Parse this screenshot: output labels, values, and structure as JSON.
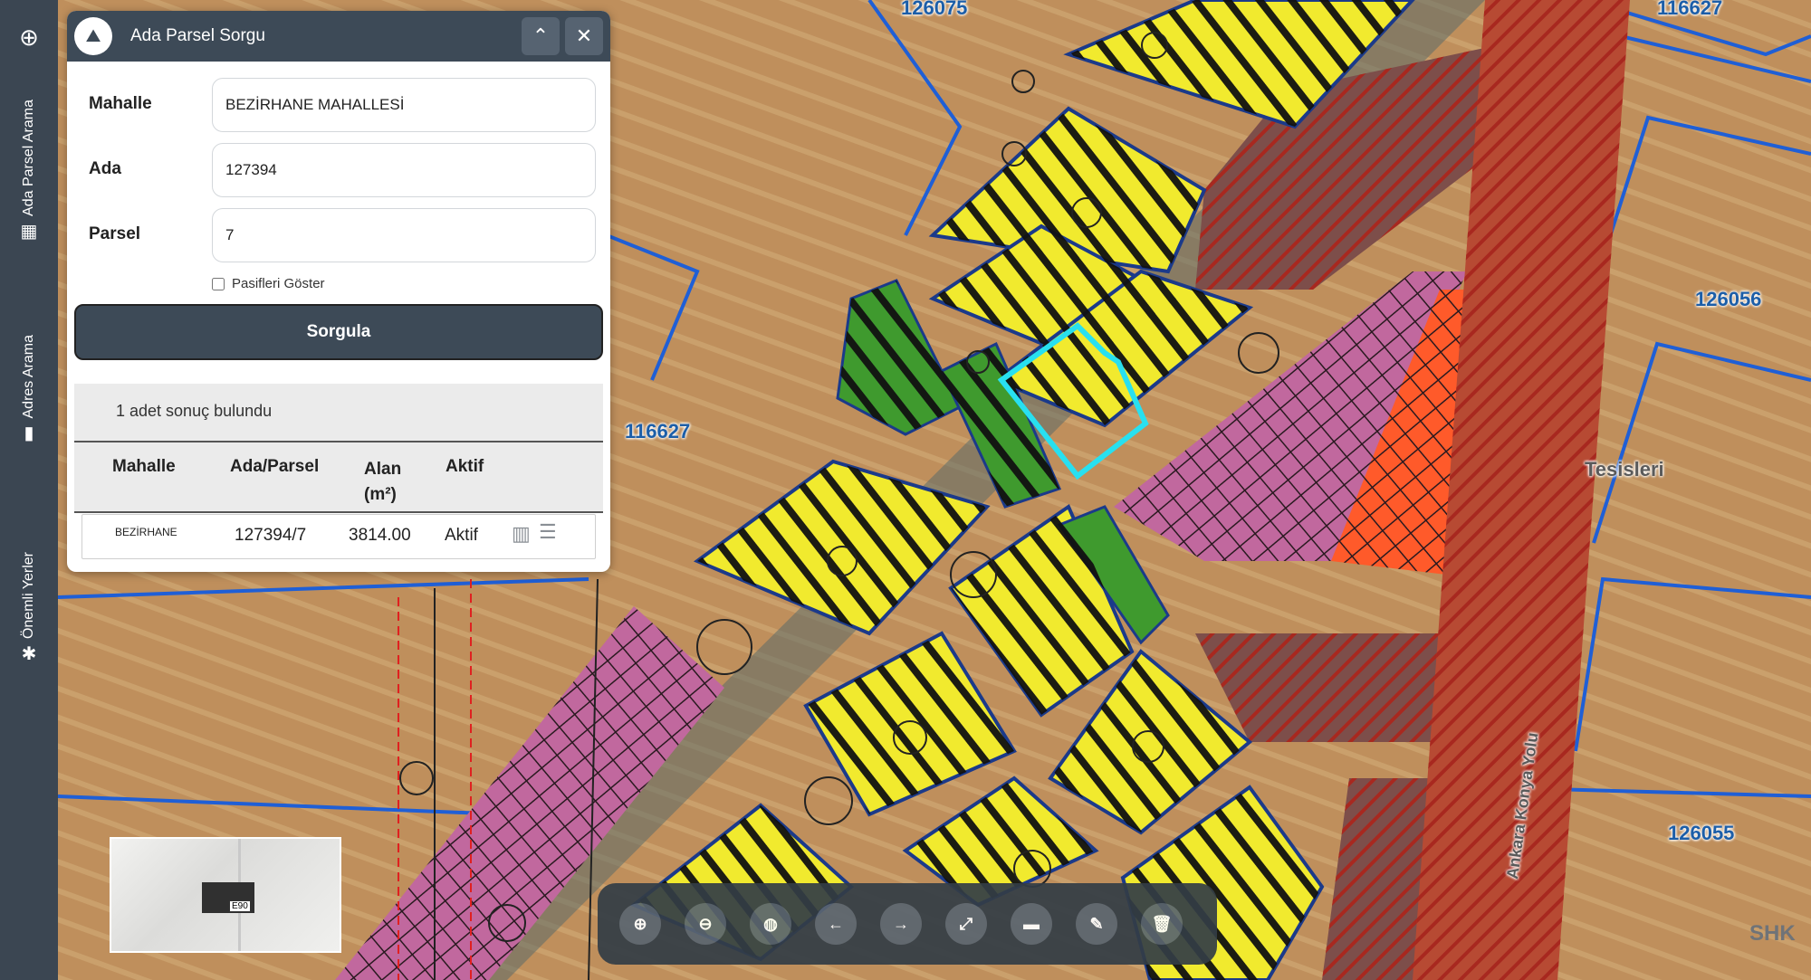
{
  "sidebar": {
    "items": [
      {
        "label": "Ada Parsel Arama",
        "icon": "building-icon"
      },
      {
        "label": "Adres Arama",
        "icon": "map-marker-icon"
      },
      {
        "label": "Önemli Yerler",
        "icon": "places-icon"
      }
    ]
  },
  "panel": {
    "title": "Ada Parsel Sorgu",
    "fields": {
      "mahalle_label": "Mahalle",
      "mahalle_value": "BEZİRHANE MAHALLESİ",
      "ada_label": "Ada",
      "ada_value": "127394",
      "parsel_label": "Parsel",
      "parsel_value": "7"
    },
    "checkbox_label": "Pasifleri Göster",
    "query_label": "Sorgula",
    "result_text": "1 adet sonuç bulundu",
    "columns": [
      "Mahalle",
      "Ada/Parsel",
      "Alan (m²)",
      "Aktif"
    ],
    "rows": [
      {
        "mahalle": "BEZİRHANE",
        "ada_parsel": "127394/7",
        "alan": "3814.00",
        "aktif": "Aktif"
      }
    ]
  },
  "map": {
    "labels": [
      "116627",
      "126056",
      "126055",
      "126075",
      "116627"
    ],
    "street_label": "Ankara Konya Yolu",
    "facility_label": "Tesisleri",
    "e90_label": "E90",
    "brand": "SHK"
  },
  "toolbar": {
    "buttons": [
      "zoom-in-icon",
      "zoom-out-icon",
      "globe-icon",
      "arrow-left-icon",
      "arrow-right-icon",
      "fullscreen-icon",
      "measure-icon",
      "edit-icon",
      "trash-icon"
    ]
  },
  "colors": {
    "panel_header": "#3d4a57",
    "highlight": "#28e0f0",
    "yellow_zone": "#f1ea2e",
    "pink_zone": "#c1689e",
    "green_zone": "#3f9a2e",
    "red_zone": "#ff5a2a"
  }
}
